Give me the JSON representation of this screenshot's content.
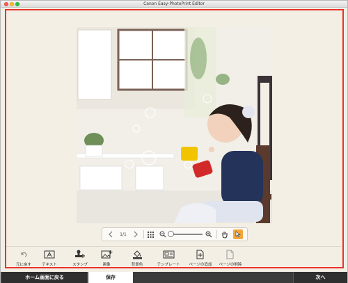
{
  "window": {
    "title": "Canon Easy-PhotoPrint Editor"
  },
  "nav": {
    "page_indicator": "1/1"
  },
  "tools": [
    {
      "label": "元に戻す",
      "icon": "undo-icon"
    },
    {
      "label": "テキスト",
      "icon": "text-icon"
    },
    {
      "label": "スタンプ",
      "icon": "stamp-icon"
    },
    {
      "label": "画像",
      "icon": "image-icon"
    },
    {
      "label": "背景色",
      "icon": "background-color-icon"
    },
    {
      "label": "テンプレート",
      "icon": "template-icon"
    },
    {
      "label": "ページの追加",
      "icon": "add-page-icon"
    },
    {
      "label": "ページの削除",
      "icon": "delete-page-icon"
    }
  ],
  "bottom": {
    "home_label": "ホーム画面に戻る",
    "save_label": "保存",
    "next_label": "次へ"
  },
  "colors": {
    "highlight_frame": "#e8332b",
    "pointer_tool": "#f3a637",
    "bottom_bar": "#3b3b3b"
  }
}
